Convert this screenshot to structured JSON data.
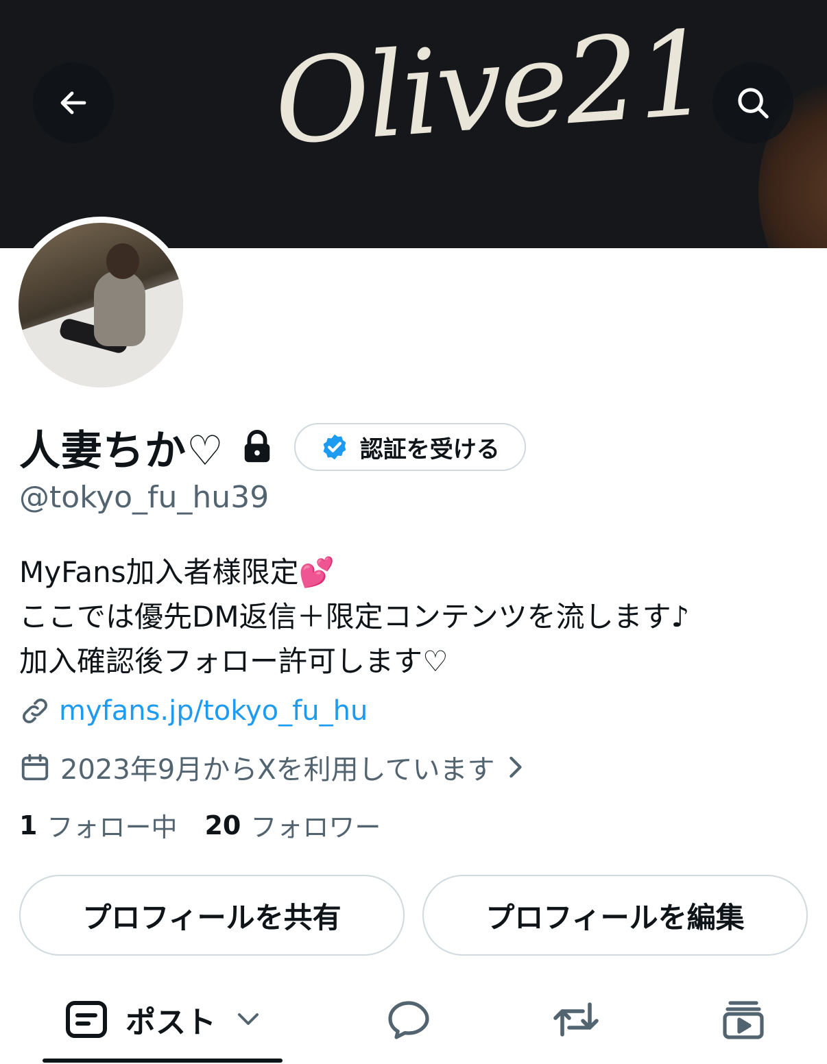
{
  "banner": {
    "logo_text": "Olive21"
  },
  "header": {
    "back_icon": "arrow-left-icon",
    "search_icon": "search-icon"
  },
  "profile": {
    "display_name": "人妻ちか♡",
    "handle": "@tokyo_fu_hu39",
    "protected_icon": "lock-icon",
    "verify_label": "認証を受ける",
    "bio_lines": [
      "MyFans加入者様限定💕",
      "ここでは優先DM返信＋限定コンテンツを流します♪",
      "加入確認後フォロー許可します♡"
    ],
    "link": "myfans.jp/tokyo_fu_hu",
    "joined": "2023年9月からXを利用しています",
    "following_count": "1",
    "following_label": "フォロー中",
    "followers_count": "20",
    "followers_label": "フォロワー"
  },
  "actions": {
    "share_label": "プロフィールを共有",
    "edit_label": "プロフィールを編集"
  },
  "tabs": {
    "posts_label": "ポスト",
    "icons": [
      "posts-icon",
      "reply-icon",
      "repost-icon",
      "media-icon"
    ]
  },
  "colors": {
    "accent": "#1d9bf0",
    "text": "#0f1419",
    "secondary": "#536471",
    "border": "#cfd9de"
  }
}
